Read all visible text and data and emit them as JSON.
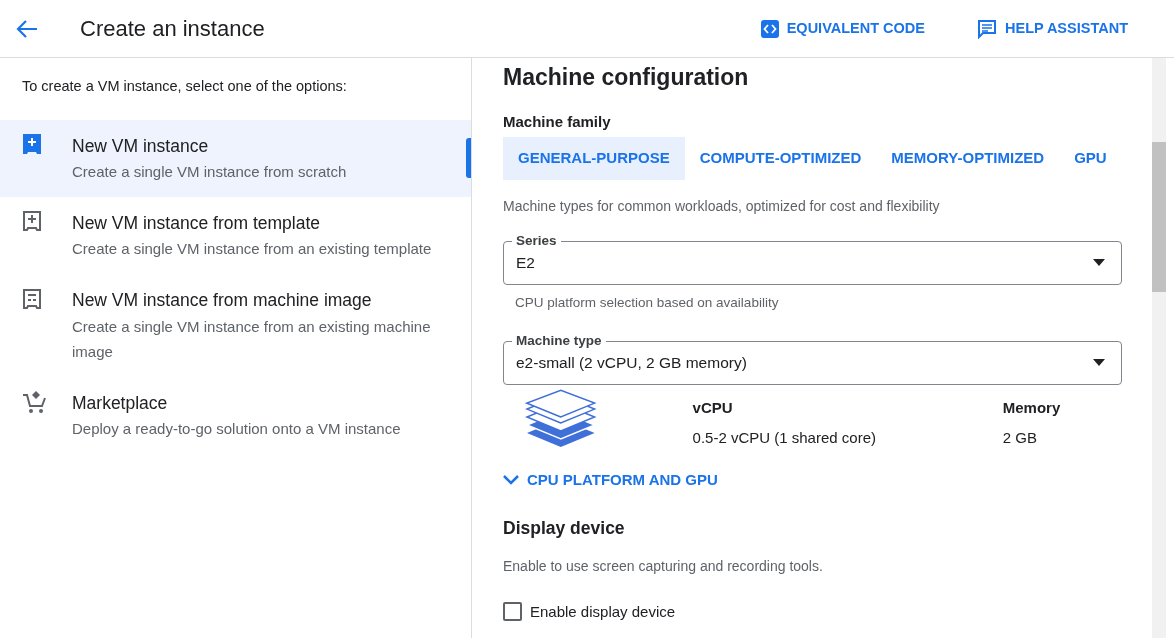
{
  "header": {
    "title": "Create an instance",
    "actions": [
      {
        "kind": "code",
        "label": "EQUIVALENT CODE"
      },
      {
        "kind": "chat",
        "label": "HELP ASSISTANT"
      }
    ]
  },
  "sidebar": {
    "intro": "To create a VM instance, select one of the options:",
    "items": [
      {
        "kind": "new",
        "title": "New VM instance",
        "subtitle": "Create a single VM instance from scratch",
        "selected": true
      },
      {
        "kind": "template",
        "title": "New VM instance from template",
        "subtitle": "Create a single VM instance from an existing template",
        "selected": false
      },
      {
        "kind": "image",
        "title": "New VM instance from machine image",
        "subtitle": "Create a single VM instance from an existing machine image",
        "selected": false
      },
      {
        "kind": "cart",
        "title": "Marketplace",
        "subtitle": "Deploy a ready-to-go solution onto a VM instance",
        "selected": false
      }
    ]
  },
  "machine_configuration": {
    "heading": "Machine configuration",
    "family_label": "Machine family",
    "tabs": [
      {
        "label": "GENERAL-PURPOSE",
        "selected": true
      },
      {
        "label": "COMPUTE-OPTIMIZED",
        "selected": false
      },
      {
        "label": "MEMORY-OPTIMIZED",
        "selected": false
      },
      {
        "label": "GPU",
        "selected": false
      }
    ],
    "description": "Machine types for common workloads, optimized for cost and flexibility",
    "series": {
      "label": "Series",
      "value": "E2",
      "hint": "CPU platform selection based on availability"
    },
    "machine_type": {
      "label": "Machine type",
      "value": "e2-small (2 vCPU, 2 GB memory)"
    },
    "specs": [
      {
        "label": "vCPU",
        "value": "0.5-2 vCPU (1 shared core)"
      },
      {
        "label": "Memory",
        "value": "2 GB"
      }
    ],
    "expander": {
      "label": "CPU PLATFORM AND GPU",
      "expanded": false
    }
  },
  "display_device": {
    "heading": "Display device",
    "description": "Enable to use screen capturing and recording tools.",
    "checkbox": {
      "label": "Enable display device",
      "checked": false
    }
  }
}
